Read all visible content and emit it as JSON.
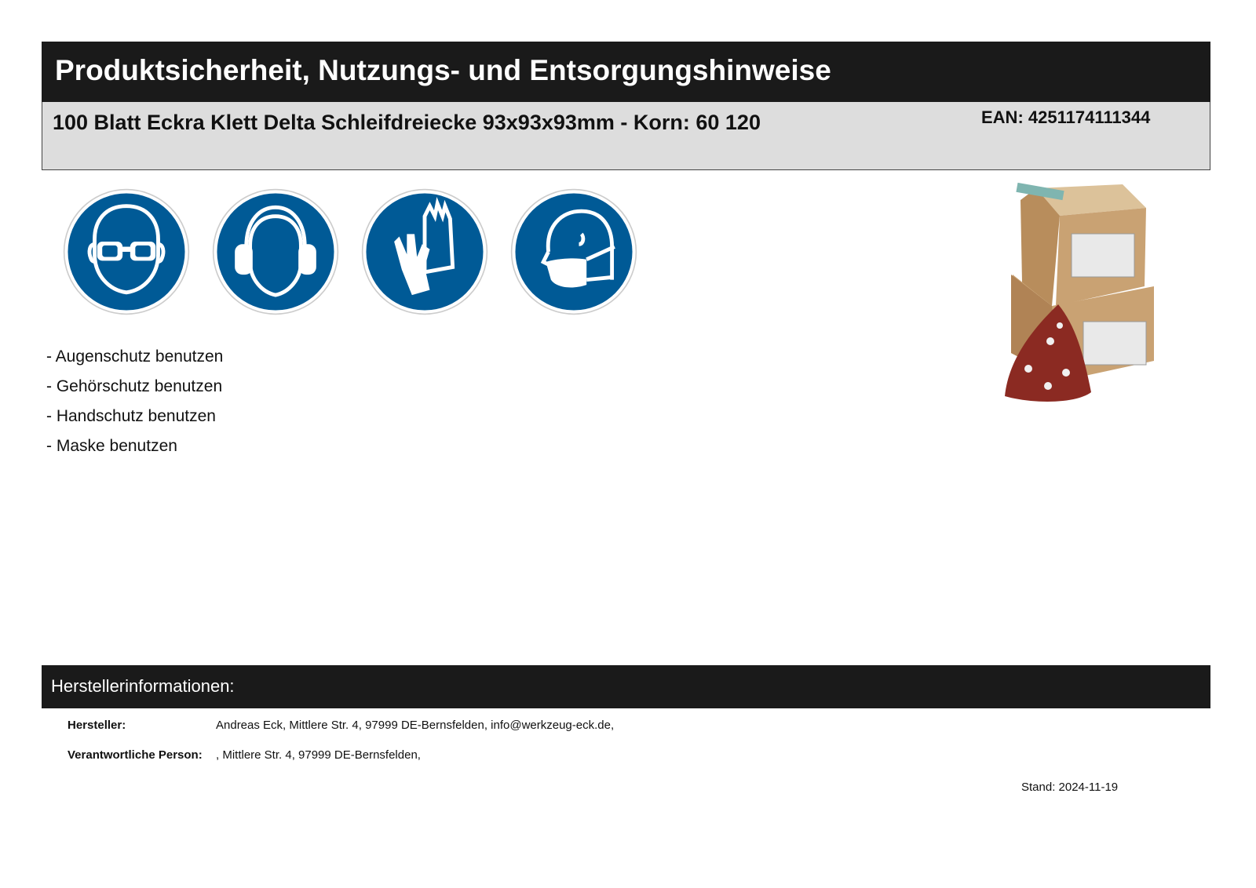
{
  "header": {
    "title": "Produktsicherheit, Nutzungs- und Entsorgungshinweise"
  },
  "product": {
    "name": "100 Blatt Eckra Klett Delta Schleifdreiecke 93x93x93mm - Korn: 60 120",
    "ean": "EAN: 4251174111344"
  },
  "safety_signs": [
    {
      "icon": "eye-protection-icon"
    },
    {
      "icon": "hearing-protection-icon"
    },
    {
      "icon": "hand-protection-icon"
    },
    {
      "icon": "mask-icon"
    }
  ],
  "hints": [
    "- Augenschutz benutzen",
    "- Gehörschutz benutzen",
    "- Handschutz benutzen",
    "- Maske benutzen"
  ],
  "manufacturer": {
    "section_title": "Herstellerinformationen:",
    "maker_label": "Hersteller:",
    "maker_value": "Andreas Eck, Mittlere Str. 4, 97999 DE-Bernsfelden, info@werkzeug-eck.de,",
    "person_label": "Verantwortliche Person:",
    "person_value": ", Mittlere Str. 4, 97999 DE-Bernsfelden,"
  },
  "stand": "Stand: 2024-11-19",
  "colors": {
    "sign_blue": "#005a96",
    "header_bg": "#1a1a1a",
    "product_bg": "#dddddd",
    "sandpaper": "#8b2a22",
    "cardboard": "#c9a273"
  }
}
